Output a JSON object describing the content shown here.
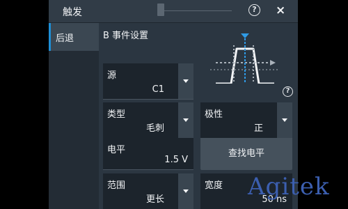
{
  "window": {
    "title": "触发"
  },
  "sidebar": {
    "items": [
      {
        "label": "后退"
      }
    ]
  },
  "section": {
    "title": "B 事件设置"
  },
  "fields": {
    "source": {
      "label": "源",
      "value": "C1"
    },
    "type": {
      "label": "类型",
      "value": "毛刺"
    },
    "polarity": {
      "label": "极性",
      "value": "正"
    },
    "level": {
      "label": "电平",
      "value": "1.5 V"
    },
    "range": {
      "label": "范围",
      "value": "更长"
    },
    "width": {
      "label": "宽度",
      "value": "50 ns"
    }
  },
  "buttons": {
    "find_level": "查找电平"
  },
  "icons": {
    "help": "?",
    "close": "×"
  },
  "watermark": "Agitek",
  "colors": {
    "accent": "#1e8fd6",
    "trigger_marker": "#2f9be6",
    "panel": "#2b3641",
    "field": "#1c242c"
  }
}
